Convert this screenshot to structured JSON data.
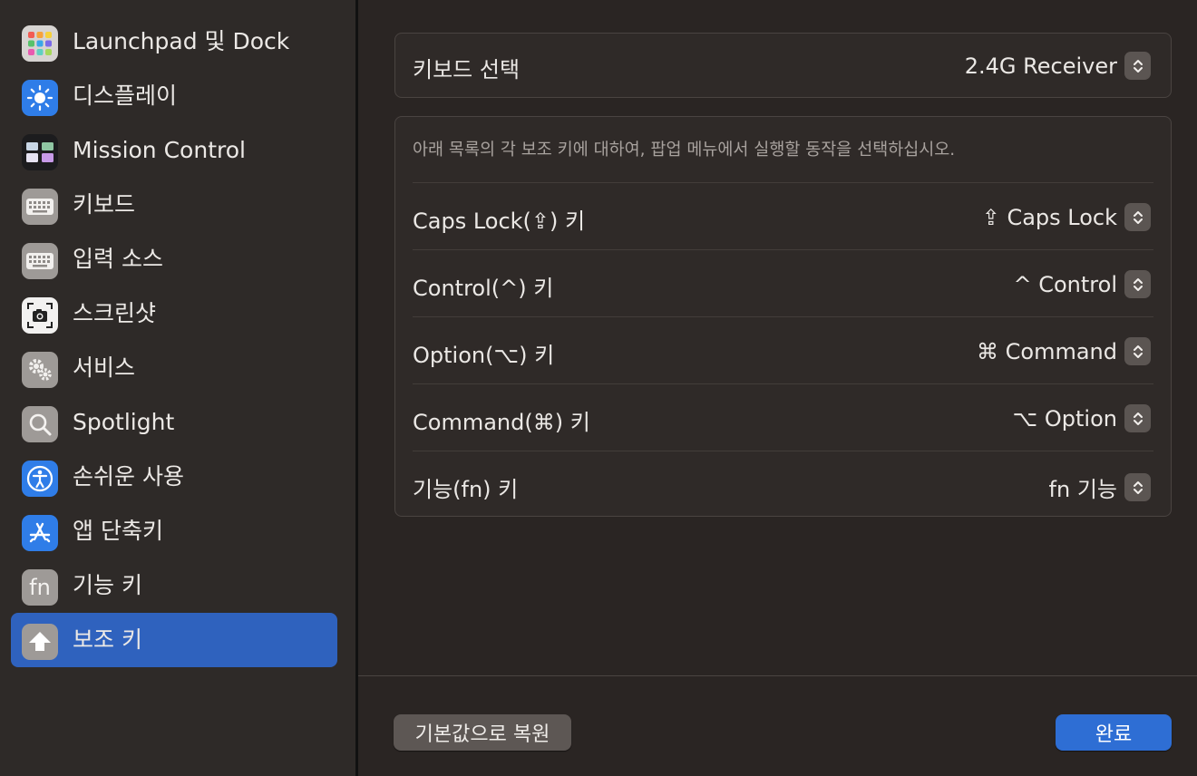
{
  "sidebar": {
    "items": [
      {
        "label": "Launchpad 및 Dock",
        "icon": "launchpad-icon"
      },
      {
        "label": "디스플레이",
        "icon": "display-brightness-icon"
      },
      {
        "label": "Mission Control",
        "icon": "mission-control-icon"
      },
      {
        "label": "키보드",
        "icon": "keyboard-icon"
      },
      {
        "label": "입력 소스",
        "icon": "keyboard-icon"
      },
      {
        "label": "스크린샷",
        "icon": "screenshot-camera-icon"
      },
      {
        "label": "서비스",
        "icon": "gears-icon"
      },
      {
        "label": "Spotlight",
        "icon": "magnifier-icon"
      },
      {
        "label": "손쉬운 사용",
        "icon": "accessibility-icon"
      },
      {
        "label": "앱 단축키",
        "icon": "app-store-icon"
      },
      {
        "label": "기능 키",
        "icon": "fn-icon",
        "glyph": "fn"
      },
      {
        "label": "보조 키",
        "icon": "modifier-arrow-icon",
        "active": true
      }
    ]
  },
  "keyboard_select": {
    "label": "키보드 선택",
    "value": "2.4G Receiver"
  },
  "modifiers": {
    "hint": "아래 목록의 각 보조 키에 대하여, 팝업 메뉴에서 실행할 동작을 선택하십시오.",
    "rows": [
      {
        "label": "Caps Lock(⇪) 키",
        "value": "⇪ Caps Lock"
      },
      {
        "label": "Control(^) 키",
        "value": "^ Control"
      },
      {
        "label": "Option(⌥) 키",
        "value": "⌘ Command"
      },
      {
        "label": "Command(⌘) 키",
        "value": "⌥ Option"
      },
      {
        "label": "기능(fn) 키",
        "value": "fn 기능"
      }
    ]
  },
  "footer": {
    "restore_defaults_label": "기본값으로 복원",
    "done_label": "완료"
  },
  "colors": {
    "accent": "#2e6ed4",
    "selection": "#2f62be",
    "background": "#2a2523"
  }
}
